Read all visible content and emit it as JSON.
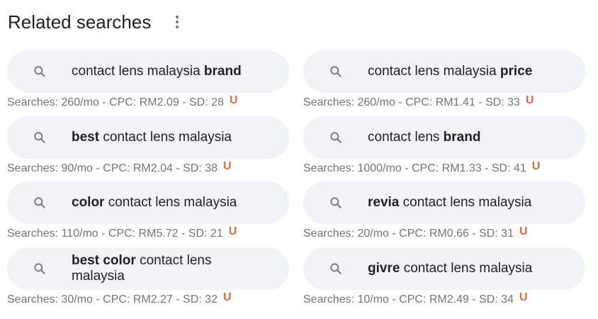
{
  "header": {
    "title": "Related searches"
  },
  "u_label": "U",
  "left": [
    {
      "pre": "contact lens malaysia ",
      "bold": "brand",
      "post": "",
      "metrics": "Searches: 260/mo - CPC: RM2.09 - SD: 28"
    },
    {
      "pre": "",
      "bold": "best",
      "post": " contact lens malaysia",
      "metrics": "Searches: 90/mo - CPC: RM2.04 - SD: 38"
    },
    {
      "pre": "",
      "bold": "color",
      "post": " contact lens malaysia",
      "metrics": "Searches: 110/mo - CPC: RM5.72 - SD: 21"
    },
    {
      "pre": "",
      "bold": "best color",
      "post": " contact lens malaysia",
      "metrics": "Searches: 30/mo - CPC: RM2.27 - SD: 32"
    }
  ],
  "right": [
    {
      "pre": "contact lens malaysia ",
      "bold": "price",
      "post": "",
      "metrics": "Searches: 260/mo - CPC: RM1.41 - SD: 33"
    },
    {
      "pre": "contact lens ",
      "bold": "brand",
      "post": "",
      "metrics": "Searches: 1000/mo - CPC: RM1.33 - SD: 41"
    },
    {
      "pre": "",
      "bold": "revia",
      "post": " contact lens malaysia",
      "metrics": "Searches: 20/mo - CPC: RM0.66 - SD: 31"
    },
    {
      "pre": "",
      "bold": "givre",
      "post": " contact lens malaysia",
      "metrics": "Searches: 10/mo - CPC: RM2.49 - SD: 34"
    }
  ]
}
